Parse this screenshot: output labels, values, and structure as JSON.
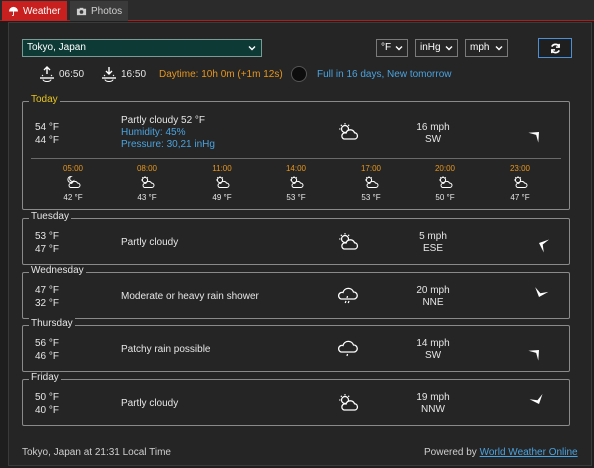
{
  "tabs": [
    {
      "label": "Weather",
      "icon": "umbrella-icon",
      "active": true
    },
    {
      "label": "Photos",
      "icon": "camera-icon",
      "active": false
    }
  ],
  "controls": {
    "location": "Tokyo, Japan",
    "temp_unit": "°F",
    "pressure_unit": "inHg",
    "speed_unit": "mph"
  },
  "sun": {
    "sunrise": "06:50",
    "sunset": "16:50",
    "daytime": "Daytime: 10h 0m (+1m 12s)",
    "moon": "Full in 16 days, New tomorrow"
  },
  "today": {
    "label": "Today",
    "high": "54 °F",
    "low": "44 °F",
    "condition": "Partly cloudy 52 °F",
    "humidity": "Humidity: 45%",
    "pressure": "Pressure: 30,21 inHg",
    "wind_speed": "16 mph",
    "wind_dir": "SW",
    "hours": [
      {
        "time": "05:00",
        "temp": "42 °F",
        "icon": "partly-cloudy-night-icon"
      },
      {
        "time": "08:00",
        "temp": "43 °F",
        "icon": "partly-cloudy-icon"
      },
      {
        "time": "11:00",
        "temp": "49 °F",
        "icon": "partly-cloudy-icon"
      },
      {
        "time": "14:00",
        "temp": "53 °F",
        "icon": "partly-cloudy-icon"
      },
      {
        "time": "17:00",
        "temp": "53 °F",
        "icon": "partly-cloudy-icon"
      },
      {
        "time": "20:00",
        "temp": "50 °F",
        "icon": "partly-cloudy-icon"
      },
      {
        "time": "23:00",
        "temp": "47 °F",
        "icon": "partly-cloudy-icon"
      }
    ]
  },
  "days": [
    {
      "label": "Tuesday",
      "high": "53 °F",
      "low": "47 °F",
      "condition": "Partly cloudy",
      "icon": "partly-cloudy-icon",
      "wind_speed": "5 mph",
      "wind_dir": "ESE"
    },
    {
      "label": "Wednesday",
      "high": "47 °F",
      "low": "32 °F",
      "condition": "Moderate or heavy rain shower",
      "icon": "rain-cloud-icon",
      "wind_speed": "20 mph",
      "wind_dir": "NNE"
    },
    {
      "label": "Thursday",
      "high": "56 °F",
      "low": "46 °F",
      "condition": "Patchy rain possible",
      "icon": "rain-cloud-icon",
      "wind_speed": "14 mph",
      "wind_dir": "SW"
    },
    {
      "label": "Friday",
      "high": "50 °F",
      "low": "40 °F",
      "condition": "Partly cloudy",
      "icon": "partly-cloudy-icon",
      "wind_speed": "19 mph",
      "wind_dir": "NNW"
    }
  ],
  "footer": {
    "local_time": "Tokyo, Japan at 21:31 Local Time",
    "powered_by": "Powered by",
    "provider": "World Weather Online"
  },
  "colors": {
    "accent": "#c8201e",
    "highlight": "#e8961a",
    "link": "#4aa3df",
    "today_label": "#e8c51a"
  }
}
